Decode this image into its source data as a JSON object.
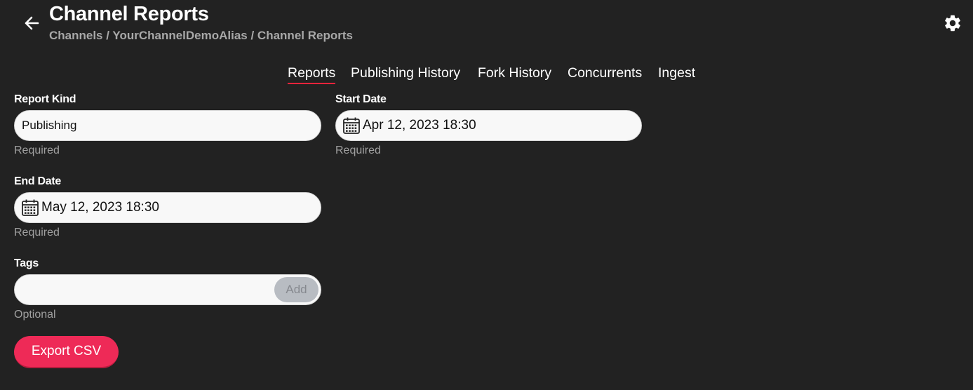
{
  "header": {
    "title": "Channel Reports",
    "breadcrumb": "Channels / YourChannelDemoAlias / Channel Reports",
    "back_icon": "arrow-left-icon",
    "settings_icon": "gear-icon"
  },
  "tabs": [
    {
      "label": "Reports",
      "active": true
    },
    {
      "label": "Publishing History",
      "active": false
    },
    {
      "label": "Fork History",
      "active": false
    },
    {
      "label": "Concurrents",
      "active": false
    },
    {
      "label": "Ingest",
      "active": false
    }
  ],
  "form": {
    "report_kind": {
      "label": "Report Kind",
      "value": "Publishing",
      "helper": "Required"
    },
    "start_date": {
      "label": "Start Date",
      "value": "Apr 12, 2023 18:30",
      "helper": "Required",
      "icon": "calendar-icon"
    },
    "end_date": {
      "label": "End Date",
      "value": "May 12, 2023 18:30",
      "helper": "Required",
      "icon": "calendar-icon"
    },
    "tags": {
      "label": "Tags",
      "value": "",
      "add_label": "Add",
      "helper": "Optional"
    }
  },
  "actions": {
    "export_label": "Export CSV"
  },
  "colors": {
    "background": "#222222",
    "accent": "#ee2a57",
    "tab_underline": "#e8243c",
    "input_bg": "#f8f8f8",
    "helper_text": "#a0a0a0"
  }
}
